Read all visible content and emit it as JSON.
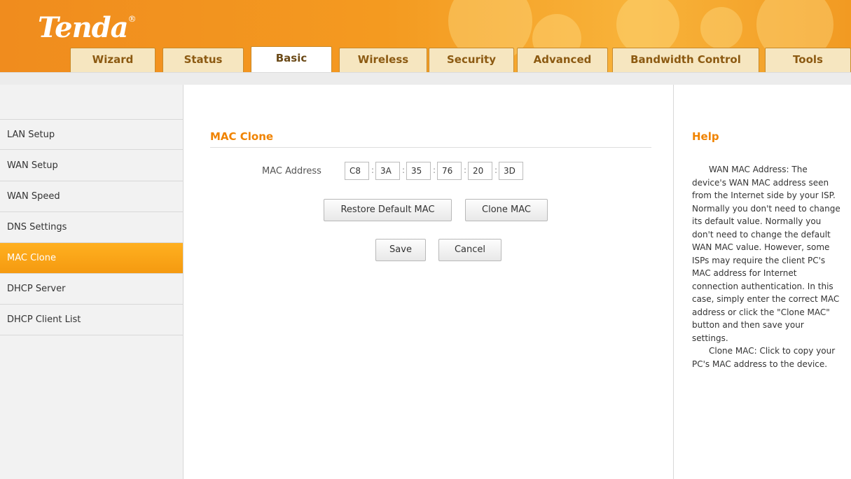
{
  "header": {
    "logo": "Tenda",
    "logo_mark": "®",
    "tabs": [
      {
        "label": "Wizard"
      },
      {
        "label": "Status"
      },
      {
        "label": "Basic"
      },
      {
        "label": "Wireless"
      },
      {
        "label": "Security"
      },
      {
        "label": "Advanced"
      },
      {
        "label": "Bandwidth Control"
      },
      {
        "label": "Tools"
      }
    ],
    "active_tab": "Basic"
  },
  "sidebar": {
    "items": [
      {
        "label": "LAN Setup"
      },
      {
        "label": "WAN Setup"
      },
      {
        "label": "WAN Speed"
      },
      {
        "label": "DNS Settings"
      },
      {
        "label": "MAC Clone"
      },
      {
        "label": "DHCP Server"
      },
      {
        "label": "DHCP Client List"
      }
    ],
    "active_item": "MAC Clone"
  },
  "main": {
    "title": "MAC Clone",
    "mac_label": "MAC Address",
    "mac_octets": [
      "C8",
      "3A",
      "35",
      "76",
      "20",
      "3D"
    ],
    "mac_separator": ":",
    "restore_button": "Restore Default MAC",
    "clone_button": "Clone MAC",
    "save_button": "Save",
    "cancel_button": "Cancel"
  },
  "help": {
    "title": "Help",
    "paragraph1": "WAN MAC Address: The device's WAN MAC address seen from the Internet side by your ISP. Normally you don't need to change its default value. Normally you don't need to change the default WAN MAC value. However, some ISPs may require the client PC's MAC address for Internet connection authentication. In this case, simply enter the correct MAC address or click the \"Clone MAC\" button and then save your settings.",
    "paragraph2": "Clone MAC: Click to copy your PC's MAC address to the device."
  },
  "colors": {
    "brand_orange": "#f08300",
    "active_item_bg": "#f59a10",
    "tab_bg": "#f6e6c0"
  }
}
